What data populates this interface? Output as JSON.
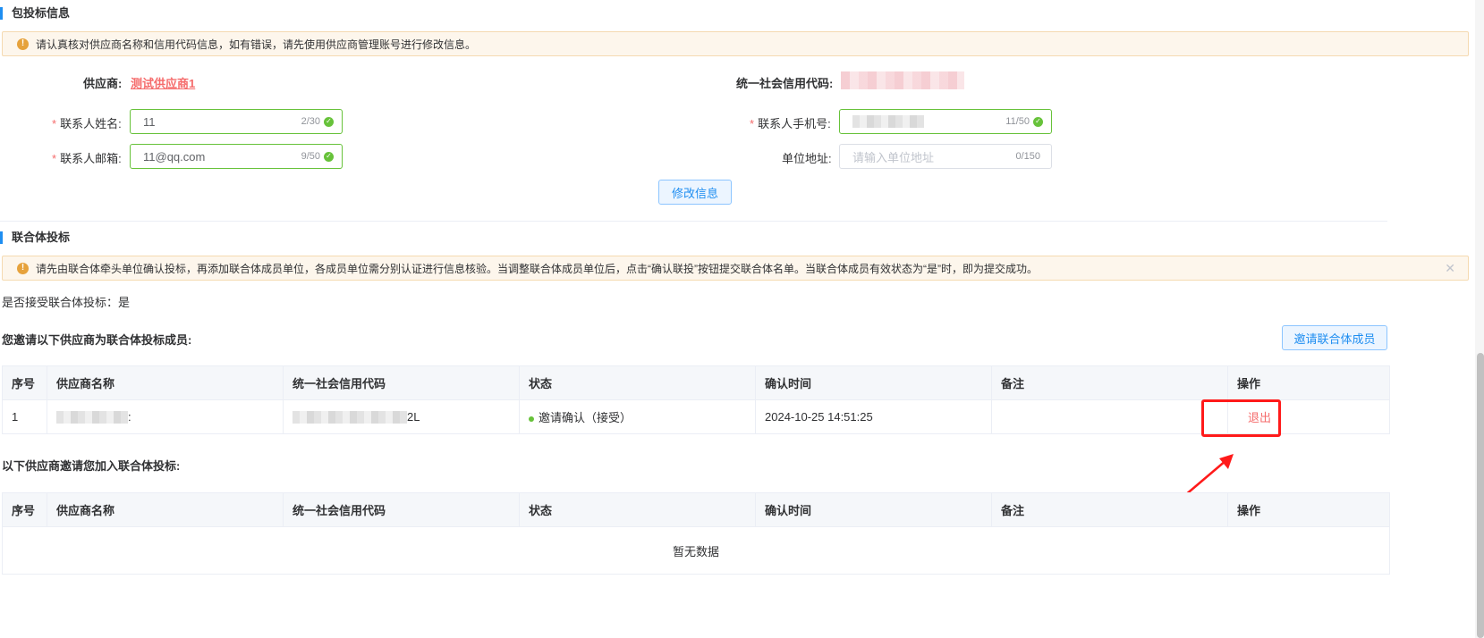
{
  "bid_info": {
    "title": "包投标信息",
    "alert": "请认真核对供应商名称和信用代码信息，如有错误，请先使用供应商管理账号进行修改信息。",
    "supplier_label": "供应商:",
    "supplier_value": "测试供应商1",
    "credit_code_label": "统一社会信用代码:",
    "contact_name_label": "联系人姓名:",
    "contact_name_value": "11",
    "contact_name_count": "2/30",
    "contact_phone_label": "联系人手机号:",
    "contact_phone_count": "11/50",
    "contact_email_label": "联系人邮箱:",
    "contact_email_value": "11@qq.com",
    "contact_email_count": "9/50",
    "address_label": "单位地址:",
    "address_placeholder": "请输入单位地址",
    "address_count": "0/150",
    "modify_button": "修改信息"
  },
  "consortium": {
    "title": "联合体投标",
    "alert": "请先由联合体牵头单位确认投标，再添加联合体成员单位，各成员单位需分别认证进行信息核验。当调整联合体成员单位后，点击“确认联投”按钮提交联合体名单。当联合体成员有效状态为“是”时，即为提交成功。",
    "accept_text": "是否接受联合体投标：是",
    "invited_title": "您邀请以下供应商为联合体投标成员:",
    "invite_button": "邀请联合体成员",
    "columns": [
      "序号",
      "供应商名称",
      "统一社会信用代码",
      "状态",
      "确认时间",
      "备注",
      "操作"
    ],
    "invited_rows": [
      {
        "index": "1",
        "name_suffix": ":",
        "code_suffix": "2L",
        "status": "邀请确认（接受）",
        "time": "2024-10-25 14:51:25",
        "remark": "",
        "action": "退出"
      }
    ],
    "received_title": "以下供应商邀请您加入联合体投标:",
    "empty_text": "暂无数据"
  },
  "colors": {
    "accent": "#1f8ef1",
    "danger": "#f56c6c",
    "success": "#67c23a",
    "warning": "#e6a23c"
  }
}
